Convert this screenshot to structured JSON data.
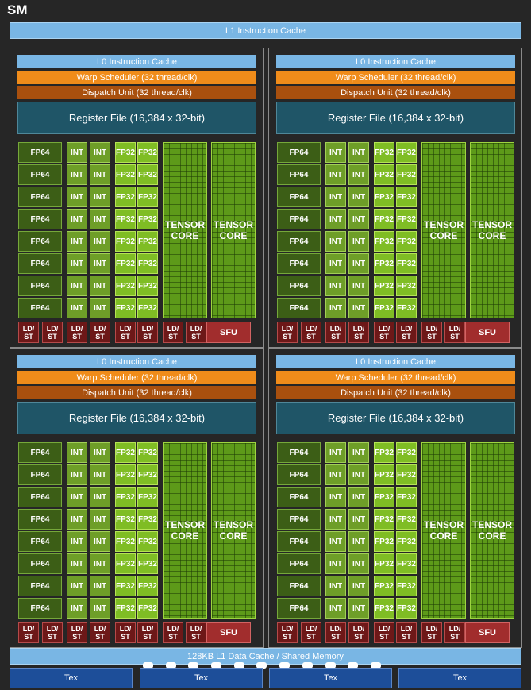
{
  "sm": {
    "title": "SM",
    "l1_instruction_cache": "L1 Instruction Cache",
    "l1_data_cache": "128KB L1 Data Cache / Shared Memory",
    "tex_units": [
      "Tex",
      "Tex",
      "Tex",
      "Tex"
    ]
  },
  "partition": {
    "l0_cache": "L0 Instruction Cache",
    "warp_scheduler": "Warp Scheduler (32 thread/clk)",
    "dispatch_unit": "Dispatch Unit (32 thread/clk)",
    "register_file": "Register File (16,384 x 32-bit)",
    "fp64": "FP64",
    "int": "INT",
    "fp32": "FP32",
    "tensor_core": "TENSOR CORE",
    "ldst": "LD/ ST",
    "sfu": "SFU",
    "unit_rows": 8,
    "ldst_count": 8
  },
  "colors": {
    "l1": "#79b6e4",
    "warp": "#f08c1a",
    "dispatch": "#a9500e",
    "register": "#1f5567",
    "fp64": "#3c5e16",
    "int": "#6e9e28",
    "fp32": "#7fbd24",
    "tensor": "#5d9a19",
    "ldst": "#6d1818",
    "sfu": "#a12d2d",
    "tex": "#1d4e99"
  }
}
